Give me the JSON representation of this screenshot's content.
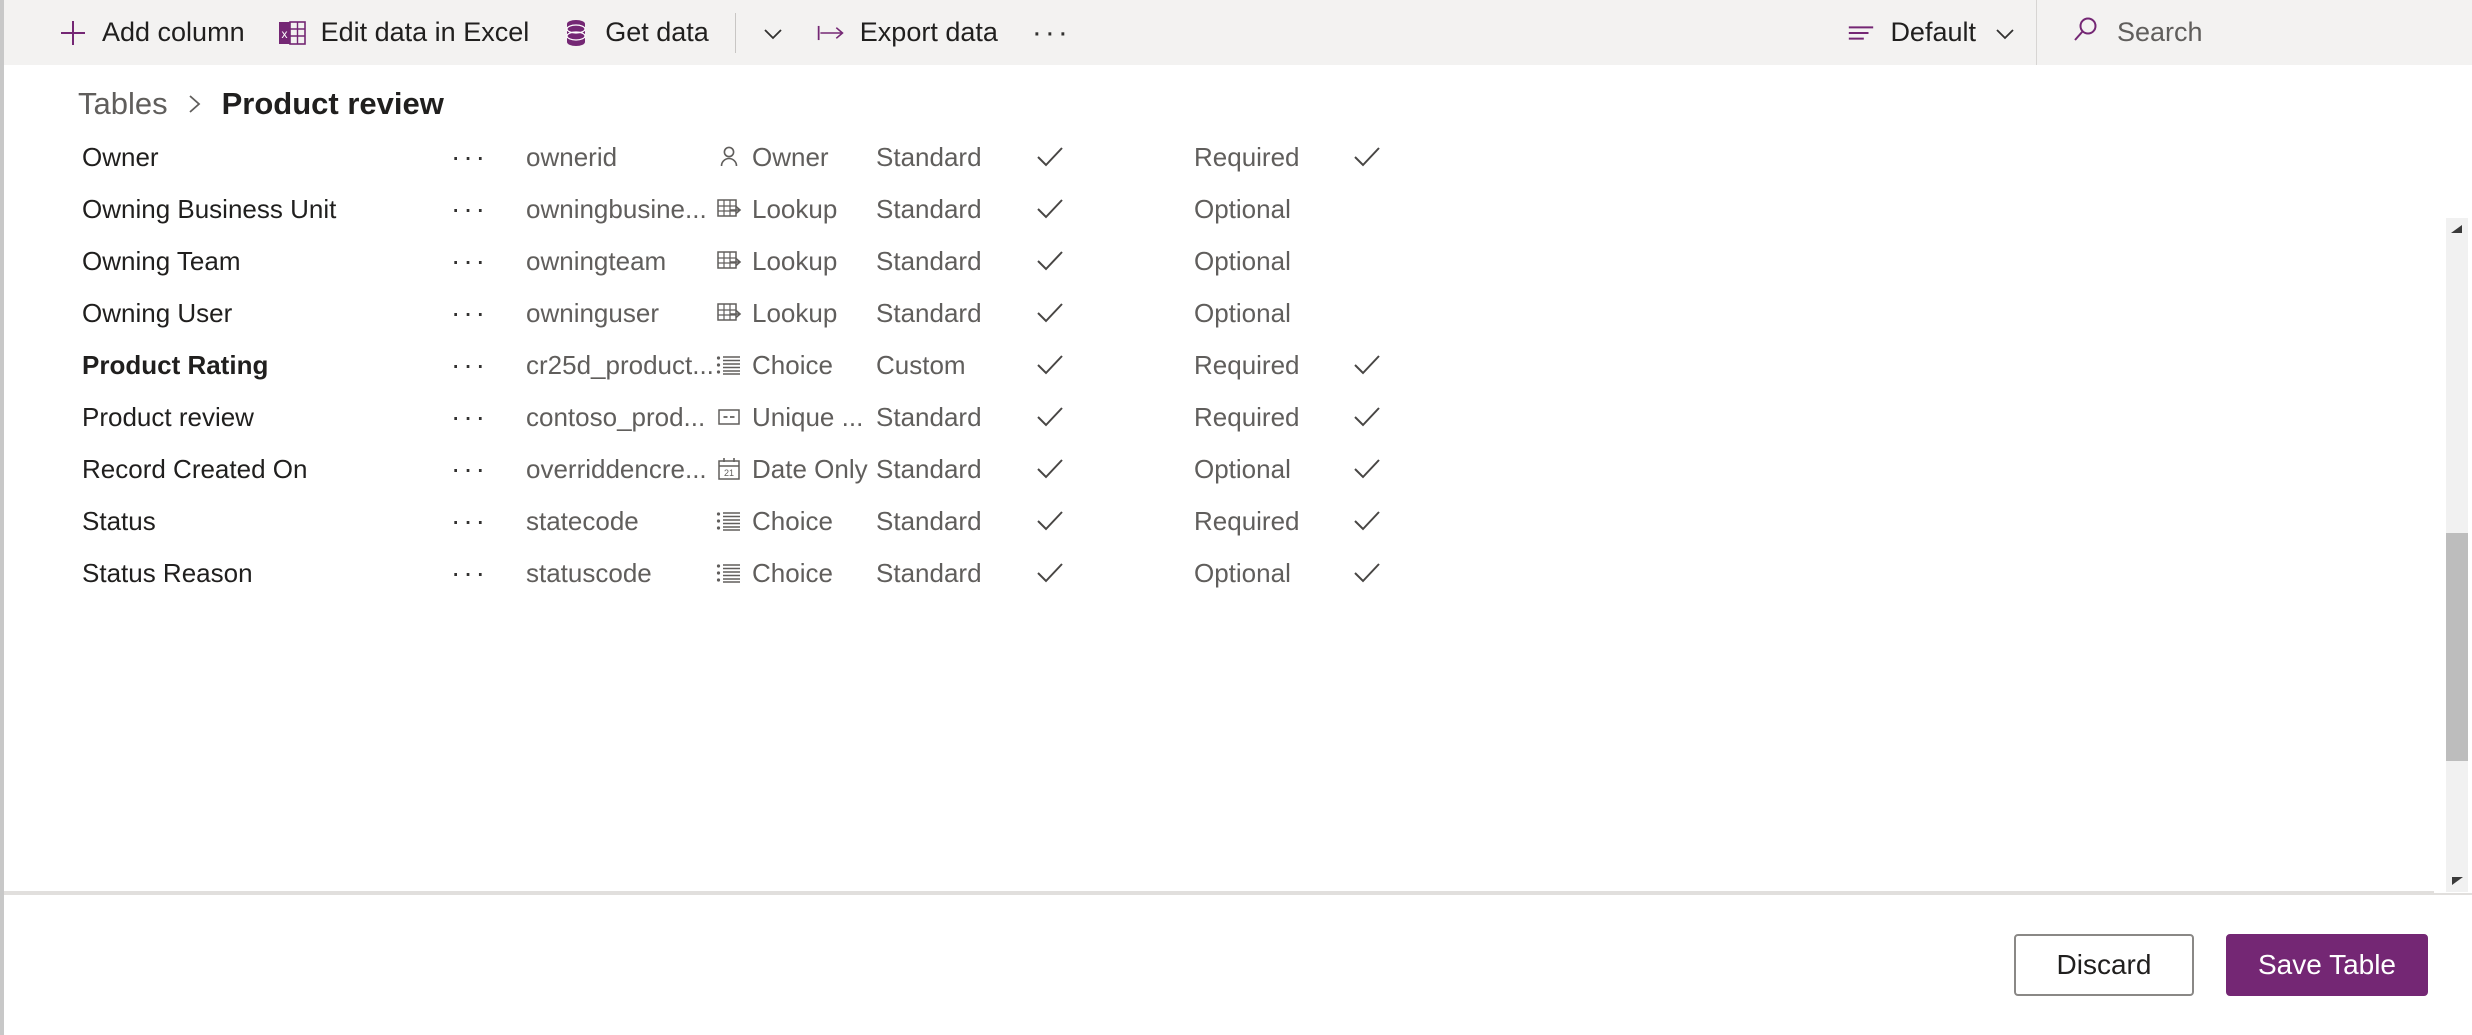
{
  "toolbar": {
    "add_column_label": "Add column",
    "edit_excel_label": "Edit data in Excel",
    "get_data_label": "Get data",
    "export_data_label": "Export data",
    "overflow_label": "···",
    "view_label": "Default",
    "search_placeholder": "Search",
    "search_value": "",
    "accent_color": "#742774",
    "background_color": "#f3f2f1"
  },
  "breadcrumb": {
    "parent": "Tables",
    "separator": "›",
    "current": "Product review"
  },
  "grid": {
    "rows": [
      {
        "display_name": "Owner",
        "bold": false,
        "more_actions": "···",
        "logical_name": "ownerid",
        "data_type": "Owner",
        "type_icon": "person-icon",
        "customization": "Standard",
        "searchable": true,
        "requirement": "Required",
        "last_flag": true
      },
      {
        "display_name": "Owning Business Unit",
        "bold": false,
        "more_actions": "···",
        "logical_name": "owningbusine...",
        "data_type": "Lookup",
        "type_icon": "lookup-icon",
        "customization": "Standard",
        "searchable": true,
        "requirement": "Optional",
        "last_flag": false
      },
      {
        "display_name": "Owning Team",
        "bold": false,
        "more_actions": "···",
        "logical_name": "owningteam",
        "data_type": "Lookup",
        "type_icon": "lookup-icon",
        "customization": "Standard",
        "searchable": true,
        "requirement": "Optional",
        "last_flag": false
      },
      {
        "display_name": "Owning User",
        "bold": false,
        "more_actions": "···",
        "logical_name": "owninguser",
        "data_type": "Lookup",
        "type_icon": "lookup-icon",
        "customization": "Standard",
        "searchable": true,
        "requirement": "Optional",
        "last_flag": false
      },
      {
        "display_name": "Product Rating",
        "bold": true,
        "more_actions": "···",
        "logical_name": "cr25d_product...",
        "data_type": "Choice",
        "type_icon": "choice-icon",
        "customization": "Custom",
        "searchable": true,
        "requirement": "Required",
        "last_flag": true
      },
      {
        "display_name": "Product review",
        "bold": false,
        "more_actions": "···",
        "logical_name": "contoso_prod...",
        "data_type": "Unique ...",
        "type_icon": "unique-identifier-icon",
        "customization": "Standard",
        "searchable": true,
        "requirement": "Required",
        "last_flag": true
      },
      {
        "display_name": "Record Created On",
        "bold": false,
        "more_actions": "···",
        "logical_name": "overriddencre...",
        "data_type": "Date Only",
        "type_icon": "calendar-icon",
        "customization": "Standard",
        "searchable": true,
        "requirement": "Optional",
        "last_flag": true
      },
      {
        "display_name": "Status",
        "bold": false,
        "more_actions": "···",
        "logical_name": "statecode",
        "data_type": "Choice",
        "type_icon": "choice-icon",
        "customization": "Standard",
        "searchable": true,
        "requirement": "Required",
        "last_flag": true
      },
      {
        "display_name": "Status Reason",
        "bold": false,
        "more_actions": "···",
        "logical_name": "statuscode",
        "data_type": "Choice",
        "type_icon": "choice-icon",
        "customization": "Standard",
        "searchable": true,
        "requirement": "Optional",
        "last_flag": true
      }
    ]
  },
  "footer": {
    "discard_label": "Discard",
    "save_label": "Save Table"
  }
}
